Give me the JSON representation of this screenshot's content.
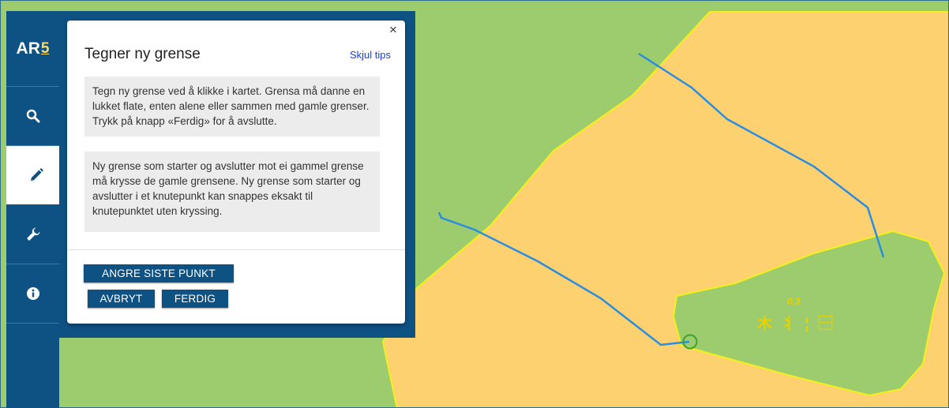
{
  "app": {
    "logo_text": "AR",
    "logo_sup": "5"
  },
  "sidebar": {
    "items": [
      {
        "icon": "search-icon",
        "active": false
      },
      {
        "icon": "pencil-icon",
        "active": true
      },
      {
        "icon": "wrench-icon",
        "active": false
      },
      {
        "icon": "info-icon",
        "active": false
      }
    ]
  },
  "panel": {
    "close_label": "×",
    "title": "Tegner ny grense",
    "hide_tips_label": "Skjul tips",
    "tip1": "Tegn ny grense ved å klikke i kartet. Grensa må danne en lukket flate, enten alene eller sammen med gamle grenser. Trykk på knapp «Ferdig» for å avslutte.",
    "tip2": "Ny grense som starter og avslutter mot ei gammel grense må krysse de gamle grensene. Ny grense som starter og avslutter i et knutepunkt kan snappes eksakt til knutepunktet uten kryssing.",
    "undo_label": "ANGRE SISTE PUNKT",
    "cancel_label": "AVBRYT",
    "done_label": "FERDIG"
  },
  "map": {
    "colors": {
      "forest": "#9dcc6f",
      "farmland": "#fdd070",
      "boundary": "#f4f01c",
      "drawn_line": "#2a8de0",
      "snap_circle": "#3aa329"
    },
    "area_label": {
      "value": "0,3",
      "symbols": "⽊ ⺦ ¦ ⿱"
    }
  }
}
